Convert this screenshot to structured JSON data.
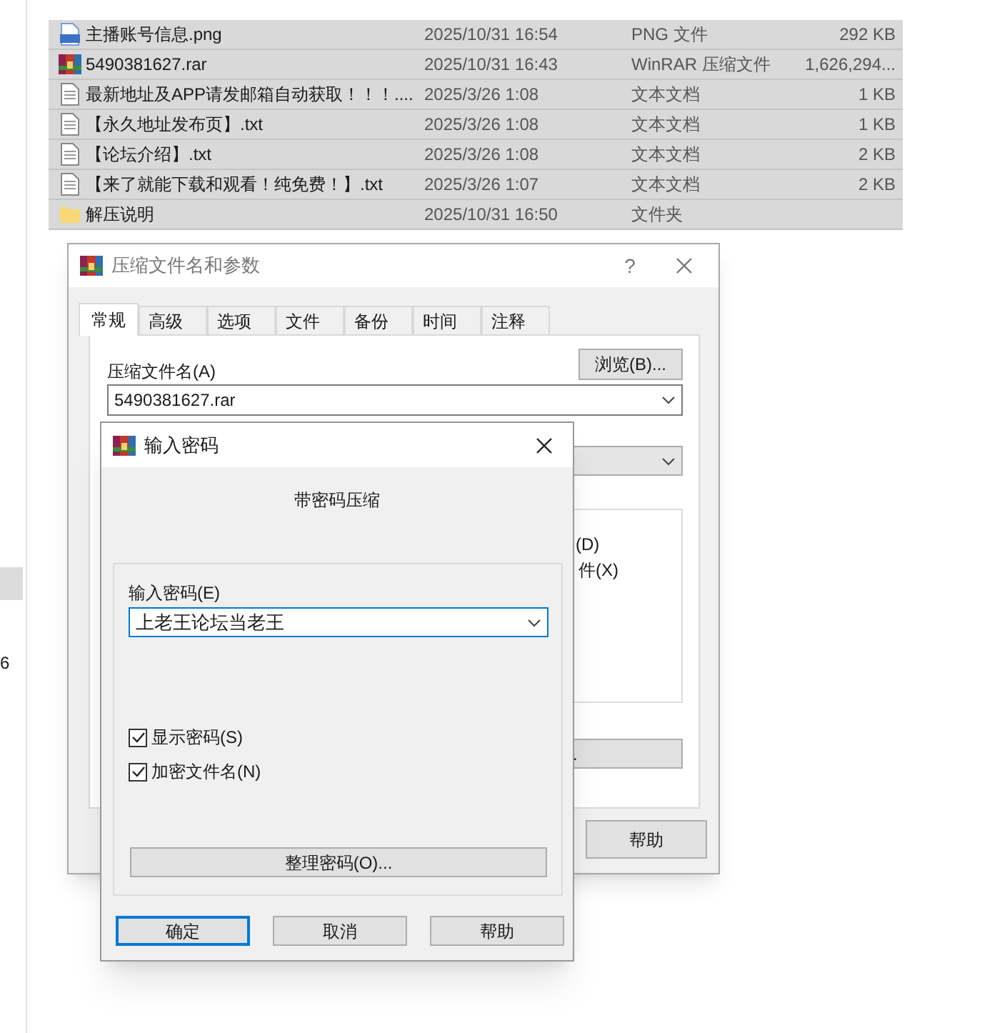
{
  "files": [
    {
      "name": "主播账号信息.png",
      "modified": "2025/10/31 16:54",
      "type": "PNG 文件",
      "size": "292 KB",
      "kind": "png"
    },
    {
      "name": "5490381627.rar",
      "modified": "2025/10/31 16:43",
      "type": "WinRAR 压缩文件",
      "size": "1,626,294...",
      "kind": "rar"
    },
    {
      "name": "最新地址及APP请发邮箱自动获取！！！....",
      "modified": "2025/3/26 1:08",
      "type": "文本文档",
      "size": "1 KB",
      "kind": "txt"
    },
    {
      "name": "【永久地址发布页】.txt",
      "modified": "2025/3/26 1:08",
      "type": "文本文档",
      "size": "1 KB",
      "kind": "txt"
    },
    {
      "name": "【论坛介绍】.txt",
      "modified": "2025/3/26 1:08",
      "type": "文本文档",
      "size": "2 KB",
      "kind": "txt"
    },
    {
      "name": "【来了就能下载和观看！纯免费！】.txt",
      "modified": "2025/3/26 1:07",
      "type": "文本文档",
      "size": "2 KB",
      "kind": "txt"
    },
    {
      "name": "解压说明",
      "modified": "2025/10/31 16:50",
      "type": "文件夹",
      "kind": "folder"
    }
  ],
  "left_pane_text": "6",
  "archive_dialog": {
    "title": "压缩文件名和参数",
    "help_glyph": "?",
    "tabs": [
      {
        "label": "常规",
        "selected": true
      },
      {
        "label": "高级",
        "selected": false
      },
      {
        "label": "选项",
        "selected": false
      },
      {
        "label": "文件",
        "selected": false
      },
      {
        "label": "备份",
        "selected": false
      },
      {
        "label": "时间",
        "selected": false
      },
      {
        "label": "注释",
        "selected": false
      }
    ],
    "browse_button": "浏览(B)...",
    "archive_name_label": "压缩文件名(A)",
    "archive_name": "5490381627.rar",
    "partial_options": [
      "(D)",
      "件(X)"
    ],
    "partial_button": ".",
    "help_button": "帮助"
  },
  "password_dialog": {
    "title": "输入密码",
    "heading": "带密码压缩",
    "password_label": "输入密码(E)",
    "password": "上老王论坛当老王",
    "options": [
      {
        "label": "显示密码(S)",
        "checked": true
      },
      {
        "label": "加密文件名(N)",
        "checked": true
      }
    ],
    "organize_button": "整理密码(O)...",
    "buttons": [
      "确定",
      "取消",
      "帮助"
    ]
  }
}
